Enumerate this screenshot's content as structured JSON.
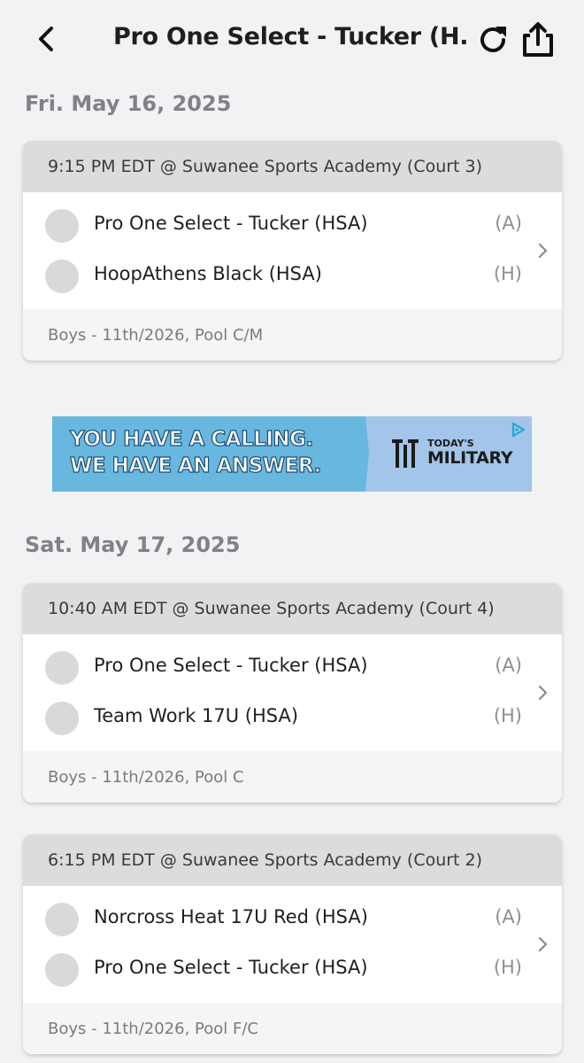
{
  "header": {
    "title": "Pro One Select - Tucker (H..."
  },
  "days": [
    {
      "date": "Fri. May 16, 2025",
      "games": [
        {
          "header": "9:15 PM EDT @ Suwanee Sports Academy (Court 3)",
          "teams": [
            {
              "name": "Pro One Select - Tucker (HSA)",
              "side": "(A)"
            },
            {
              "name": "HoopAthens Black (HSA)",
              "side": "(H)"
            }
          ],
          "footer": "Boys - 11th/2026, Pool C/M"
        }
      ]
    },
    {
      "date": "Sat. May 17, 2025",
      "games": [
        {
          "header": "10:40 AM EDT @ Suwanee Sports Academy (Court 4)",
          "teams": [
            {
              "name": "Pro One Select - Tucker (HSA)",
              "side": "(A)"
            },
            {
              "name": "Team Work 17U (HSA)",
              "side": "(H)"
            }
          ],
          "footer": "Boys - 11th/2026, Pool C"
        },
        {
          "header": "6:15 PM EDT @ Suwanee Sports Academy (Court 2)",
          "teams": [
            {
              "name": "Norcross Heat 17U Red (HSA)",
              "side": "(A)"
            },
            {
              "name": "Pro One Select - Tucker (HSA)",
              "side": "(H)"
            }
          ],
          "footer": "Boys - 11th/2026, Pool F/C"
        }
      ]
    }
  ],
  "ad": {
    "line1": "YOU HAVE A CALLING.",
    "line2": "WE HAVE AN ANSWER.",
    "brand_small": "TODAY'S",
    "brand_big": "MILITARY",
    "colors": {
      "left_bg": "#68b7df",
      "right_bg": "#a3c5e9",
      "text_outline": "#1c4d75"
    }
  },
  "icons": {
    "back": "chevron-left-icon",
    "refresh": "refresh-icon",
    "share": "share-icon",
    "row_chevron": "chevron-right-icon",
    "ad_choices": "ad-choices-icon"
  },
  "colors": {
    "background": "#f1f2f4",
    "card_header_bg": "#dcdcdc",
    "card_footer_bg": "#f5f5f5",
    "date_text": "#808285",
    "logo_placeholder": "#d9d9d9"
  }
}
